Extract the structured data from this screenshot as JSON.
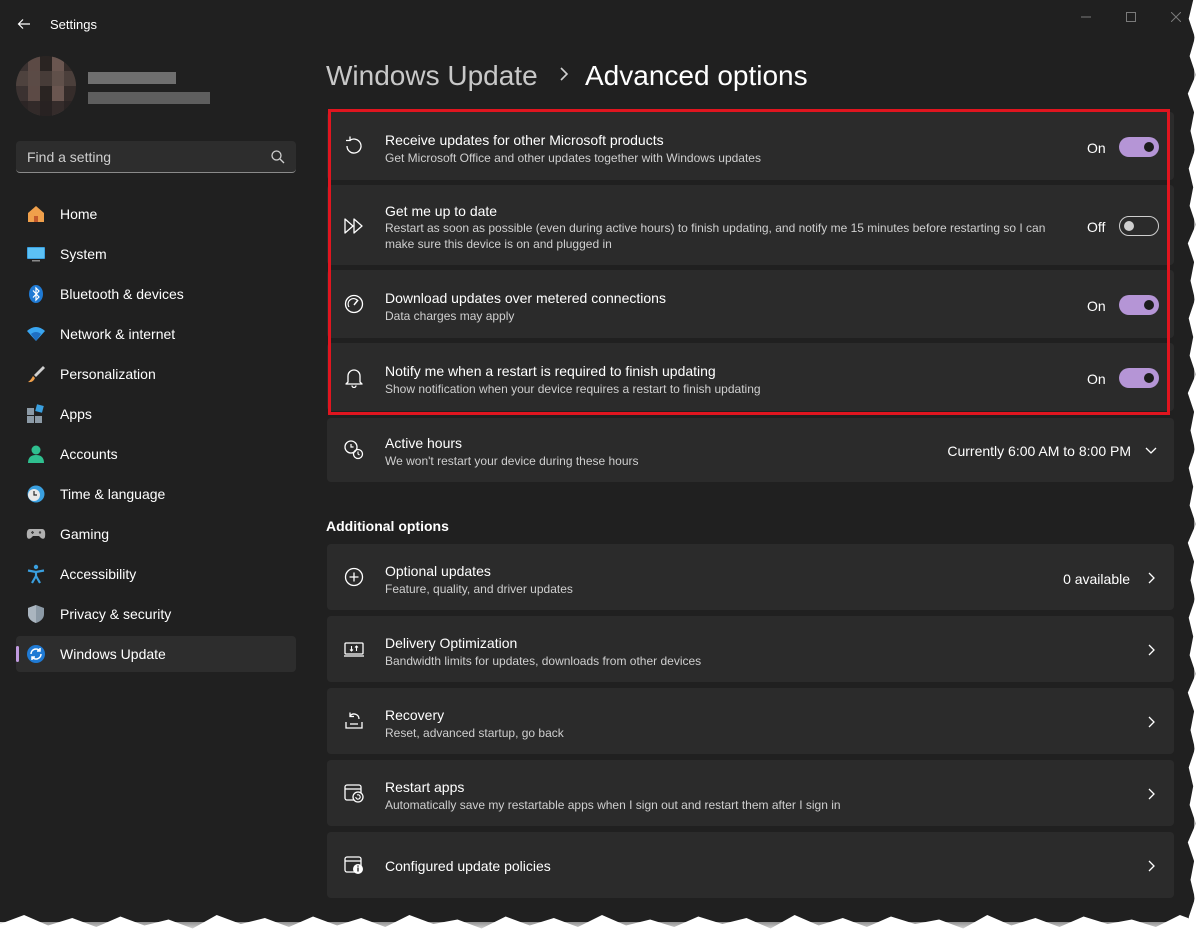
{
  "window": {
    "title": "Settings",
    "controls": [
      "minimize-icon",
      "maximize-icon",
      "close-icon"
    ]
  },
  "profile": {
    "name": "",
    "email": ""
  },
  "search": {
    "placeholder": "Find a setting"
  },
  "sidebar": {
    "items": [
      {
        "label": "Home",
        "icon": "home-icon"
      },
      {
        "label": "System",
        "icon": "system-icon"
      },
      {
        "label": "Bluetooth & devices",
        "icon": "bluetooth-icon"
      },
      {
        "label": "Network & internet",
        "icon": "wifi-icon"
      },
      {
        "label": "Personalization",
        "icon": "brush-icon"
      },
      {
        "label": "Apps",
        "icon": "apps-icon"
      },
      {
        "label": "Accounts",
        "icon": "accounts-icon"
      },
      {
        "label": "Time & language",
        "icon": "time-language-icon"
      },
      {
        "label": "Gaming",
        "icon": "gamepad-icon"
      },
      {
        "label": "Accessibility",
        "icon": "accessibility-icon"
      },
      {
        "label": "Privacy & security",
        "icon": "shield-icon"
      },
      {
        "label": "Windows Update",
        "icon": "windows-update-icon",
        "active": true
      }
    ]
  },
  "breadcrumb": {
    "parent": "Windows Update",
    "current": "Advanced options"
  },
  "settings": [
    {
      "title": "Receive updates for other Microsoft products",
      "subtitle": "Get Microsoft Office and other updates together with Windows updates",
      "state": "On",
      "icon": "refresh-icon"
    },
    {
      "title": "Get me up to date",
      "subtitle": "Restart as soon as possible (even during active hours) to finish updating, and notify me 15 minutes before restarting so I can make sure this device is on and plugged in",
      "state": "Off",
      "icon": "fast-forward-icon"
    },
    {
      "title": "Download updates over metered connections",
      "subtitle": "Data charges may apply",
      "state": "On",
      "icon": "speedometer-icon"
    },
    {
      "title": "Notify me when a restart is required to finish updating",
      "subtitle": "Show notification when your device requires a restart to finish updating",
      "state": "On",
      "icon": "bell-icon"
    }
  ],
  "active_hours": {
    "title": "Active hours",
    "subtitle": "We won't restart your device during these hours",
    "value": "Currently 6:00 AM to 8:00 PM"
  },
  "additional": {
    "heading": "Additional options",
    "items": [
      {
        "title": "Optional updates",
        "subtitle": "Feature, quality, and driver updates",
        "value": "0 available",
        "icon": "plus-circle-icon"
      },
      {
        "title": "Delivery Optimization",
        "subtitle": "Bandwidth limits for updates, downloads from other devices",
        "value": "",
        "icon": "delivery-optimization-icon"
      },
      {
        "title": "Recovery",
        "subtitle": "Reset, advanced startup, go back",
        "value": "",
        "icon": "recovery-icon"
      },
      {
        "title": "Restart apps",
        "subtitle": "Automatically save my restartable apps when I sign out and restart them after I sign in",
        "value": "",
        "icon": "restart-apps-icon"
      },
      {
        "title": "Configured update policies",
        "subtitle": "",
        "value": "",
        "icon": "policy-icon"
      }
    ]
  },
  "colors": {
    "background": "#202020",
    "card": "#2b2b2b",
    "accent": "#b595d6",
    "highlight_border": "#e0151f"
  }
}
